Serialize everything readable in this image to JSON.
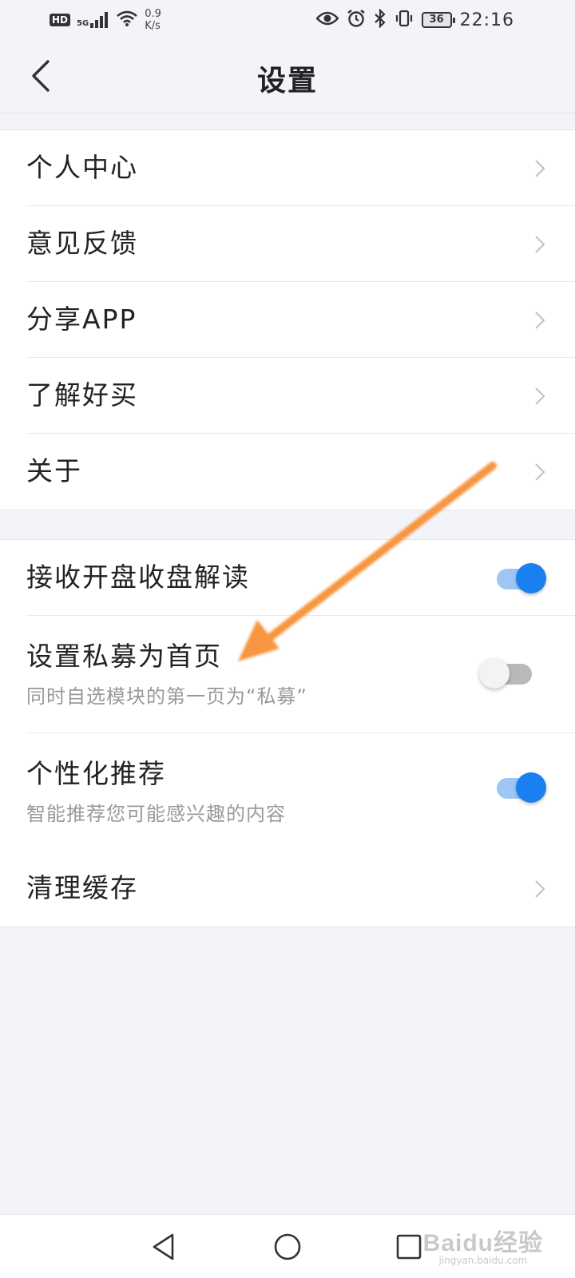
{
  "status_bar": {
    "hd": "HD",
    "signal": "5G",
    "net_speed_value": "0.9",
    "net_speed_unit": "K/s",
    "battery": "36",
    "time": "22:16"
  },
  "header": {
    "title": "设置"
  },
  "groups": [
    {
      "items": [
        {
          "label": "个人中心"
        },
        {
          "label": "意见反馈"
        },
        {
          "label": "分享APP"
        },
        {
          "label": "了解好买"
        },
        {
          "label": "关于"
        }
      ]
    },
    {
      "items": [
        {
          "label": "接收开盘收盘解读",
          "toggle": true
        },
        {
          "label": "设置私募为首页",
          "subtitle": "同时自选模块的第一页为“私募”",
          "toggle": false
        },
        {
          "label": "个性化推荐",
          "subtitle": "智能推荐您可能感兴趣的内容",
          "toggle": true
        },
        {
          "label": "清理缓存"
        }
      ]
    }
  ],
  "watermark": {
    "logo": "Baidu经验",
    "url": "jingyan.baidu.com"
  },
  "colors": {
    "accent": "#1a7ff0",
    "annotation_arrow": "#f7953f",
    "background": "#f2f4f9"
  }
}
